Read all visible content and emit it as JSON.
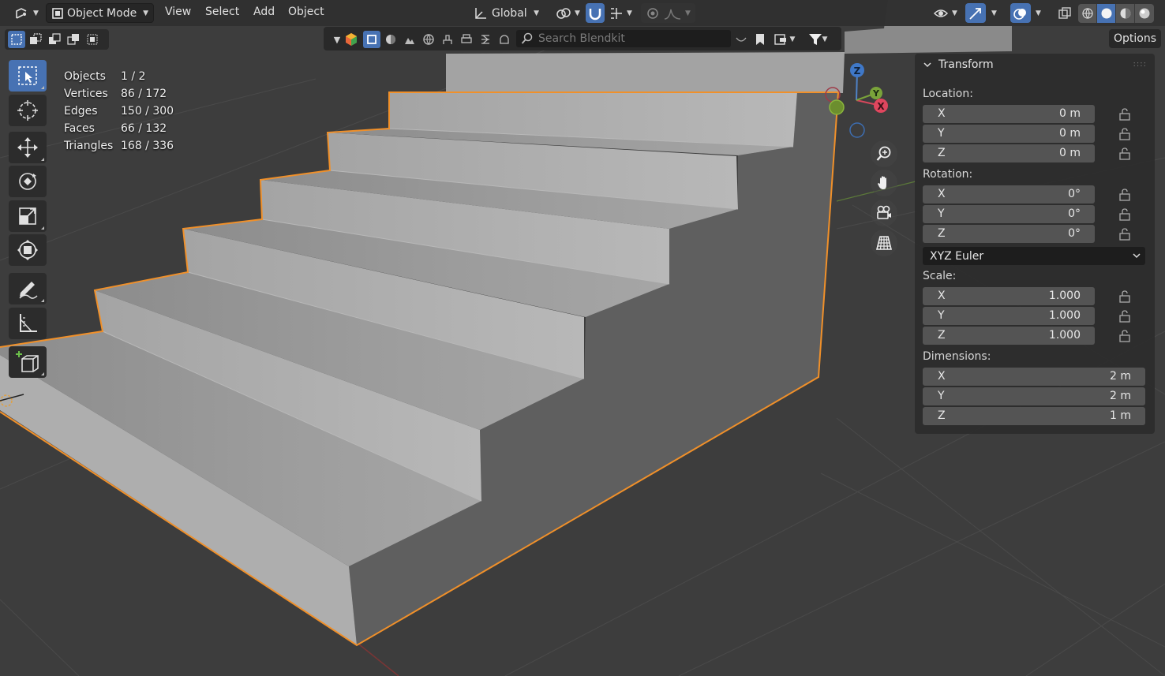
{
  "header": {
    "mode": "Object Mode",
    "menus": [
      "View",
      "Select",
      "Add",
      "Object"
    ],
    "orientation": "Global"
  },
  "blendkit": {
    "search_placeholder": "Search Blendkit"
  },
  "options_label": "Options",
  "stats": [
    {
      "label": "Objects",
      "value": "1 / 2"
    },
    {
      "label": "Vertices",
      "value": "86 / 172"
    },
    {
      "label": "Edges",
      "value": "150 / 300"
    },
    {
      "label": "Faces",
      "value": "66 / 132"
    },
    {
      "label": "Triangles",
      "value": "168 / 336"
    }
  ],
  "gizmo": {
    "z": "Z",
    "y": "Y",
    "x": "X"
  },
  "panel": {
    "title": "Transform",
    "location_label": "Location:",
    "location": [
      {
        "axis": "X",
        "value": "0 m"
      },
      {
        "axis": "Y",
        "value": "0 m"
      },
      {
        "axis": "Z",
        "value": "0 m"
      }
    ],
    "rotation_label": "Rotation:",
    "rotation": [
      {
        "axis": "X",
        "value": "0°"
      },
      {
        "axis": "Y",
        "value": "0°"
      },
      {
        "axis": "Z",
        "value": "0°"
      }
    ],
    "rotation_mode": "XYZ Euler",
    "scale_label": "Scale:",
    "scale": [
      {
        "axis": "X",
        "value": "1.000"
      },
      {
        "axis": "Y",
        "value": "1.000"
      },
      {
        "axis": "Z",
        "value": "1.000"
      }
    ],
    "dimensions_label": "Dimensions:",
    "dimensions": [
      {
        "axis": "X",
        "value": "2 m"
      },
      {
        "axis": "Y",
        "value": "2 m"
      },
      {
        "axis": "Z",
        "value": "1 m"
      }
    ]
  },
  "colors": {
    "accent_blue": "#4772b3",
    "selection_outline": "#f0902a",
    "mesh_top": "#a0a0a0",
    "mesh_side": "#5e5e5e",
    "viewport_bg": "#3d3d3d"
  }
}
